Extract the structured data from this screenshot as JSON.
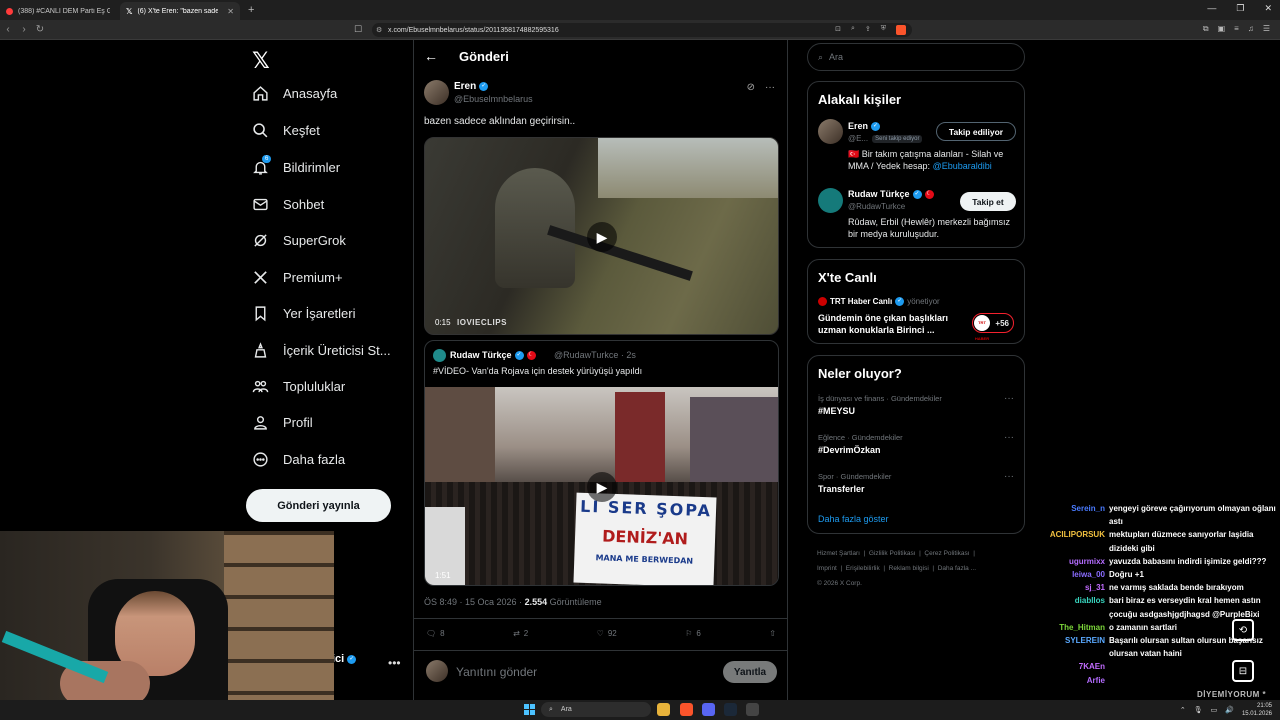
{
  "browser": {
    "tabs": [
      {
        "title": "(388) #CANLI DEM Parti Eş Genel Başk",
        "active": false
      },
      {
        "title": "(6) X'te Eren: \"bazen sadece akl",
        "active": true
      }
    ],
    "url": "x.com/Ebuselmnbelarus/status/2011358174882595316"
  },
  "nav": {
    "items": [
      {
        "label": "Anasayfa",
        "icon": "home-icon"
      },
      {
        "label": "Keşfet",
        "icon": "search-icon"
      },
      {
        "label": "Bildirimler",
        "icon": "bell-icon",
        "badge": "6"
      },
      {
        "label": "Sohbet",
        "icon": "mail-icon"
      },
      {
        "label": "SuperGrok",
        "icon": "grok-icon"
      },
      {
        "label": "Premium+",
        "icon": "x-icon"
      },
      {
        "label": "Yer İşaretleri",
        "icon": "bookmark-icon"
      },
      {
        "label": "İçerik Üreticisi St...",
        "icon": "creator-icon"
      },
      {
        "label": "Topluluklar",
        "icon": "communities-icon"
      },
      {
        "label": "Profil",
        "icon": "profile-icon"
      },
      {
        "label": "Daha fazla",
        "icon": "more-circle-icon"
      }
    ],
    "post_button": "Gönderi yayınla",
    "account_name_fragment": "ici"
  },
  "main": {
    "title": "Gönderi",
    "post": {
      "name": "Eren",
      "handle": "@Ebuselmnbelarus",
      "text": "bazen sadece aklından geçirirsin..",
      "video_time": "0:15",
      "video_watermark": "IOVIECLIPS"
    },
    "quote": {
      "name": "Rudaw Türkçe",
      "handle": "@RudawTurkce · 2s",
      "text": "#VİDEO- Van'da Rojava için destek yürüyüşü yapıldı",
      "video_time": "1:51",
      "banner_l1": "LI SER ŞOPA",
      "banner_l2": "DENİZ'AN",
      "banner_l3": "MANA ME BERWEDAN"
    },
    "meta_time": "ÖS 8:49 · 15 Oca 2026 · ",
    "meta_views": "2.554",
    "meta_views_label": " Görüntüleme",
    "actions": {
      "replies": "8",
      "reposts": "2",
      "likes": "92",
      "bookmarks": "6"
    },
    "reply_placeholder": "Yanıtını gönder",
    "reply_button": "Yanıtla"
  },
  "right": {
    "search_placeholder": "Ara",
    "related": {
      "title": "Alakalı kişiler",
      "people": [
        {
          "name": "Eren",
          "handle": "@E...",
          "tag": "Seni takip ediyor",
          "bio_prefix": "🇹🇷 Bir takım çatışma alanları - Silah ve MMA / Yedek hesap: ",
          "bio_link": "@Ebubaraldibi",
          "button": "Takip ediliyor"
        },
        {
          "name": "Rudaw Türkçe",
          "handle": "@RudawTurkce",
          "bio": "Rûdaw, Erbil (Hewlêr) merkezli bağımsız bir medya kuruluşudur.",
          "button": "Takip et"
        }
      ]
    },
    "live": {
      "title": "X'te Canlı",
      "host": "TRT Haber Canlı",
      "role": "yönetiyor",
      "text": "Gündemin öne çıkan başlıkları uzman konuklarla Birinci ...",
      "count": "+56",
      "mini_logo": "TRT HABER"
    },
    "trends": {
      "title": "Neler oluyor?",
      "items": [
        {
          "category": "İş dünyası ve finans · Gündemdekiler",
          "name": "#MEYSU"
        },
        {
          "category": "Eğlence · Gündemdekiler",
          "name": "#DevrimÖzkan"
        },
        {
          "category": "Spor · Gündemdekiler",
          "name": "Transferler"
        }
      ],
      "show_more": "Daha fazla göster"
    },
    "footer": [
      "Hizmet Şartları",
      "Gizlilik Politikası",
      "Çerez Politikası",
      "Imprint",
      "Erişilebilirlik",
      "Reklam bilgisi",
      "Daha fazla ...",
      "© 2026 X Corp."
    ]
  },
  "chat": [
    {
      "user": "Serein_n",
      "color": "#4a7bff",
      "text": "yengeyi göreve çağırıyorum olmayan oğlanı astı"
    },
    {
      "user": "ACILIPORSUK",
      "color": "#f0c040",
      "text": "mektupları düzmece sanıyorlar laşidia dizideki gibi"
    },
    {
      "user": "ugurmixx",
      "color": "#b46cff",
      "text": "yavuzda babasını indirdi işimize geldi???"
    },
    {
      "user": "leiwa_00",
      "color": "#8a6cff",
      "text": "Doğru +1"
    },
    {
      "user": "sj_31",
      "color": "#c26cff",
      "text": "ne varmış saklada bende bırakıyom"
    },
    {
      "user": "diabllos",
      "color": "#39d6c0",
      "text": "bari biraz es verseydin kral hemen astın çocuğu asdgashjgdjhagsd @PurpleBixi"
    },
    {
      "user": "The_Hitman",
      "color": "#7cd63a",
      "text": "o zamanın sartlari"
    },
    {
      "user": "SYLEREIN",
      "color": "#5aa9ff",
      "text": "Başarılı olursan sultan olursun başarısız olursan vatan haini"
    },
    {
      "user": "7KAEn",
      "color": "#c26cff",
      "text": ""
    },
    {
      "user": "Arfie",
      "color": "#b46cff",
      "text": ""
    }
  ],
  "stream_overlay": "DİYEMİYORUM *",
  "taskbar": {
    "search": "Ara",
    "time": "21:05",
    "date": "15.01.2026"
  }
}
